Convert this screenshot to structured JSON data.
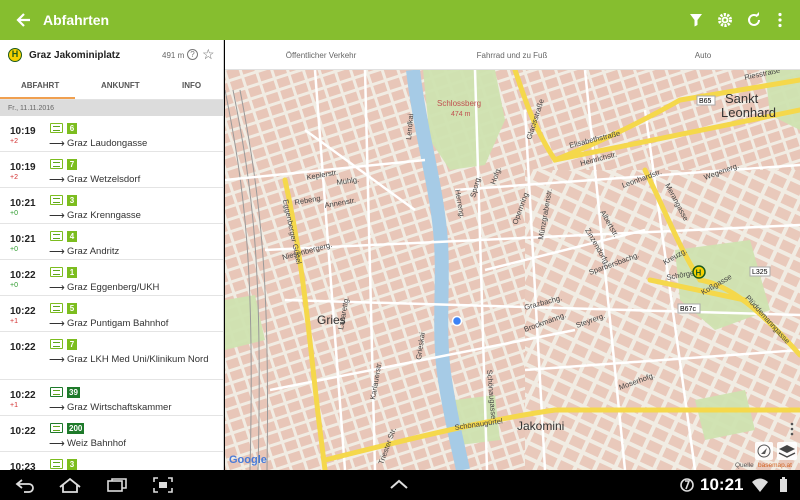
{
  "appbar": {
    "title": "Abfahrten"
  },
  "stop": {
    "badge": "H",
    "name": "Graz Jakominiplatz",
    "distance": "491 m",
    "info_glyph": "?"
  },
  "tabs": [
    "ABFAHRT",
    "ANKUNFT",
    "INFO"
  ],
  "date": "Fr., 11.11.2016",
  "departures": [
    {
      "time": "10:19",
      "delay": "+2",
      "line": "6",
      "type": "tram",
      "dest": "Graz Laudongasse"
    },
    {
      "time": "10:19",
      "delay": "+2",
      "line": "7",
      "type": "tram",
      "dest": "Graz Wetzelsdorf"
    },
    {
      "time": "10:21",
      "delay": "+0",
      "line": "3",
      "type": "tram",
      "dest": "Graz Krenngasse"
    },
    {
      "time": "10:21",
      "delay": "+0",
      "line": "4",
      "type": "tram",
      "dest": "Graz Andritz"
    },
    {
      "time": "10:22",
      "delay": "+0",
      "line": "1",
      "type": "tram",
      "dest": "Graz Eggenberg/UKH"
    },
    {
      "time": "10:22",
      "delay": "+1",
      "line": "5",
      "type": "tram",
      "dest": "Graz Puntigam Bahnhof"
    },
    {
      "time": "10:22",
      "delay": "",
      "line": "7",
      "type": "tram",
      "dest": "Graz LKH Med Uni/Klinikum Nord"
    },
    {
      "time": "10:22",
      "delay": "+1",
      "line": "39",
      "type": "bus",
      "dest": "Graz Wirtschaftskammer"
    },
    {
      "time": "10:22",
      "delay": "",
      "line": "200",
      "type": "bus",
      "dest": "Weiz Bahnhof"
    },
    {
      "time": "10:23",
      "delay": "",
      "line": "3",
      "type": "tram",
      "dest": ""
    }
  ],
  "modes": [
    "Öffentlicher Verkehr",
    "Fahrrad und zu Fuß",
    "Auto"
  ],
  "map": {
    "labels": {
      "schlossberg": "Schlossberg",
      "schlossberg_alt": "474 m",
      "sankt": "Sankt",
      "leonhard": "Leonhard",
      "gries": "Gries",
      "jakomini": "Jakomini",
      "elisabethstrasse": "Elisabethstraße",
      "glacisstrasse": "Glacisstraße",
      "schoenaugurtel": "Schönaugürtel",
      "eggenberger_guertel": "Eggenberger Gürtel",
      "merangasse": "Merangasse",
      "riesstrasse": "Riesstraße",
      "kossgasse": "Koßgasse",
      "plueddemanngasse": "Plüddemanngasse",
      "b65": "B65",
      "b67c": "B67c",
      "l325": "L325",
      "annenstr": "Annenstr.",
      "muehlg": "Mühlg.",
      "keplerstr": "Keplerstr.",
      "rebeng": "Rebeng.",
      "niesenbergerg": "Niesenbergerg.",
      "grieskai": "Grieskai",
      "lendkai": "Lendkai",
      "schoenaugasse": "Schönaugasse",
      "muenzgrabenstr": "Münzgrabenstr.",
      "steyrerg": "Steyrerg.",
      "brockmanng": "Brockmanng.",
      "opernring": "Opernring",
      "hauptplatz": "Herreng.",
      "sporg": "Sporg.",
      "hofg": "Hofg.",
      "lazarettg": "Lazarettg.",
      "karlauerstr": "Karlauerstr.",
      "triesterstr": "Triester Str.",
      "moserhofg": "Moserhofg.",
      "schoergelg": "Schörgelg.",
      "kreuzg": "Kreuzg.",
      "wegenerg": "Wegenerg.",
      "leonhardstr": "Leonhardstr.",
      "zinzendorfg": "Zinzendorfg.",
      "heinrichstr": "Heinrichstr.",
      "grazbachg": "Grazbachg.",
      "albertstr": "Albertstr.",
      "stemptlg": "Sparbersbachg."
    },
    "google": "Google",
    "source": "Quelle",
    "basemap": "basemap.at"
  },
  "status": {
    "time": "10:21"
  },
  "colors": {
    "primary": "#86be2f",
    "tram": "#7cbd1f",
    "bus": "#1e7a2a",
    "delay": "#d32f2f",
    "ontime": "#2e9b2e"
  }
}
